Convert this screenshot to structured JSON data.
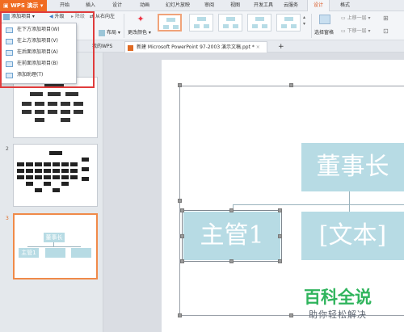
{
  "app": {
    "brand": "WPS 演示"
  },
  "menu": {
    "tabs": [
      "开始",
      "插入",
      "设计",
      "动画",
      "幻灯片放映",
      "审阅",
      "视图",
      "开发工具",
      "云服务",
      "设计",
      "格式"
    ]
  },
  "ribbon": {
    "add_item": "添加项目",
    "promote": "升级",
    "demote": "降级",
    "right_to_left": "从右向左",
    "layout_label": "布局",
    "change_color": "更改颜色",
    "select_pane": "选择窗格",
    "move_up": "上移一层",
    "move_down": "下移一层"
  },
  "dropdown": {
    "items": [
      "在下方添加项目(W)",
      "在上方添加项目(V)",
      "在后面添加项目(A)",
      "在前面添加项目(B)",
      "添加助理(T)"
    ]
  },
  "doc_tabs": {
    "tab1": "我的WPS",
    "tab2": "新建 Microsoft PowerPoint 97-2003 演示文稿.ppt *",
    "add": "+"
  },
  "thumbnails": {
    "numbers": [
      "2",
      "3"
    ]
  },
  "slide": {
    "nodes": {
      "top": "董事长",
      "left": "主管1",
      "right": "[文本]"
    },
    "thumb_nodes": {
      "top": "董事长",
      "left": "主管1"
    }
  },
  "watermark": {
    "title": "百科全说",
    "subtitle": "助你轻松解决"
  },
  "colors": {
    "brand": "#f06c22",
    "node_fill": "#b7dbe4",
    "highlight": "#e03c3c",
    "watermark": "#2fb45c"
  }
}
